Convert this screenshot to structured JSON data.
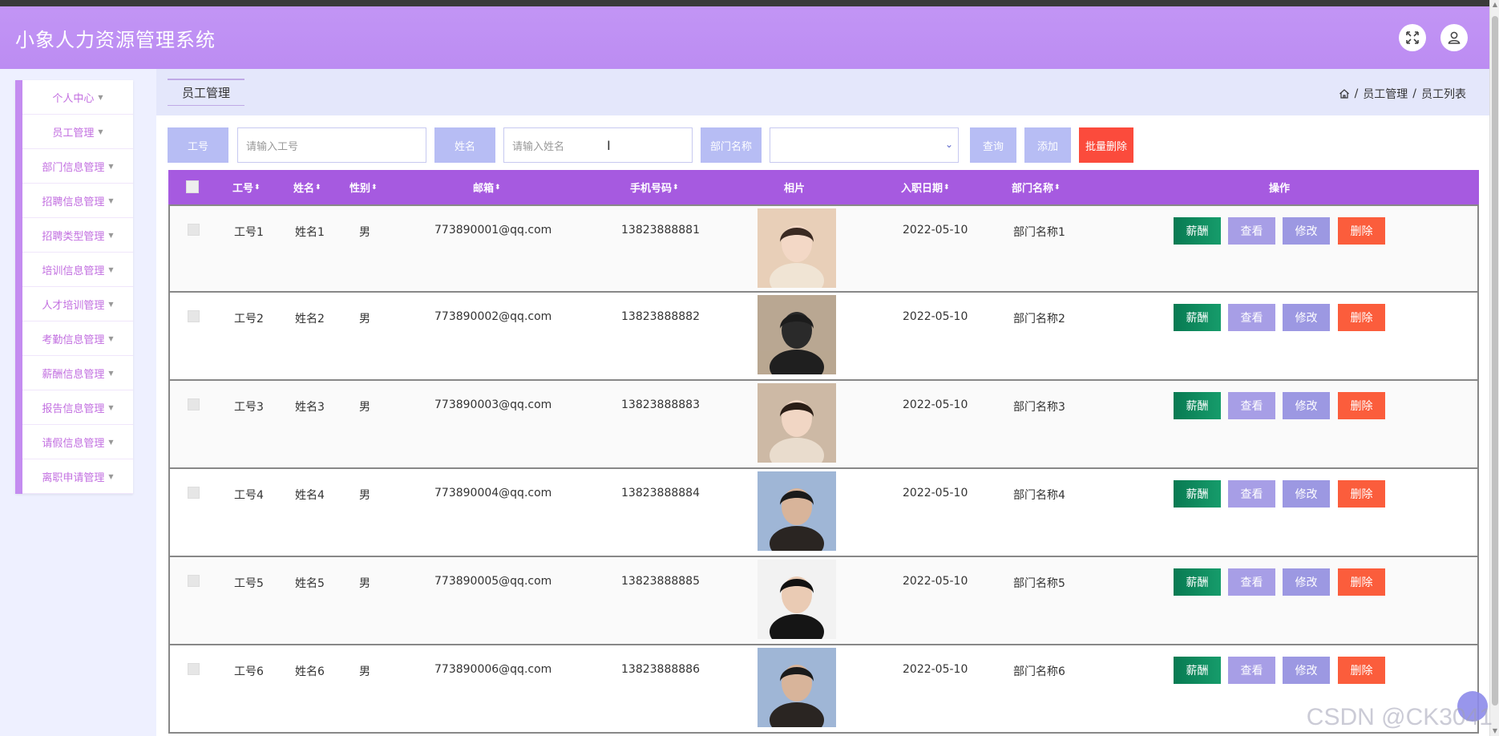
{
  "app": {
    "title": "小象人力资源管理系统"
  },
  "header": {
    "fullscreen_icon": "fullscreen-icon",
    "user_icon": "user-icon"
  },
  "sidebar": {
    "items": [
      {
        "label": "个人中心"
      },
      {
        "label": "员工管理"
      },
      {
        "label": "部门信息管理"
      },
      {
        "label": "招聘信息管理"
      },
      {
        "label": "招聘类型管理"
      },
      {
        "label": "培训信息管理"
      },
      {
        "label": "人才培训管理"
      },
      {
        "label": "考勤信息管理"
      },
      {
        "label": "薪酬信息管理"
      },
      {
        "label": "报告信息管理"
      },
      {
        "label": "请假信息管理"
      },
      {
        "label": "离职申请管理"
      }
    ]
  },
  "tab": {
    "label": "员工管理"
  },
  "breadcrumb": {
    "home_icon": "home-icon",
    "sep": "/",
    "level1": "员工管理",
    "level2": "员工列表"
  },
  "search": {
    "id_label": "工号",
    "id_placeholder": "请输入工号",
    "name_label": "姓名",
    "name_placeholder": "请输入姓名",
    "dept_label": "部门名称",
    "dept_value": "",
    "query_btn": "查询",
    "add_btn": "添加",
    "batch_delete_btn": "批量删除"
  },
  "table": {
    "headers": {
      "id": "工号",
      "name": "姓名",
      "gender": "性别",
      "email": "邮箱",
      "phone": "手机号码",
      "photo": "相片",
      "join_date": "入职日期",
      "dept": "部门名称",
      "actions": "操作"
    },
    "actions": {
      "salary": "薪酬",
      "view": "查看",
      "edit": "修改",
      "delete": "删除"
    },
    "rows": [
      {
        "id": "工号1",
        "name": "姓名1",
        "gender": "男",
        "email": "773890001@qq.com",
        "phone": "13823888881",
        "join_date": "2022-05-10",
        "dept": "部门名称1"
      },
      {
        "id": "工号2",
        "name": "姓名2",
        "gender": "男",
        "email": "773890002@qq.com",
        "phone": "13823888882",
        "join_date": "2022-05-10",
        "dept": "部门名称2"
      },
      {
        "id": "工号3",
        "name": "姓名3",
        "gender": "男",
        "email": "773890003@qq.com",
        "phone": "13823888883",
        "join_date": "2022-05-10",
        "dept": "部门名称3"
      },
      {
        "id": "工号4",
        "name": "姓名4",
        "gender": "男",
        "email": "773890004@qq.com",
        "phone": "13823888884",
        "join_date": "2022-05-10",
        "dept": "部门名称4"
      },
      {
        "id": "工号5",
        "name": "姓名5",
        "gender": "男",
        "email": "773890005@qq.com",
        "phone": "13823888885",
        "join_date": "2022-05-10",
        "dept": "部门名称5"
      },
      {
        "id": "工号6",
        "name": "姓名6",
        "gender": "男",
        "email": "773890006@qq.com",
        "phone": "13823888886",
        "join_date": "2022-05-10",
        "dept": "部门名称6"
      }
    ]
  },
  "watermark": "CSDN @CK3041",
  "colors": {
    "header": "#c295f5",
    "table_header": "#a65ae0",
    "salary_btn": "#0b7e56",
    "delete_btn": "#fb5d3c",
    "label_bg": "#b7bdf4"
  }
}
